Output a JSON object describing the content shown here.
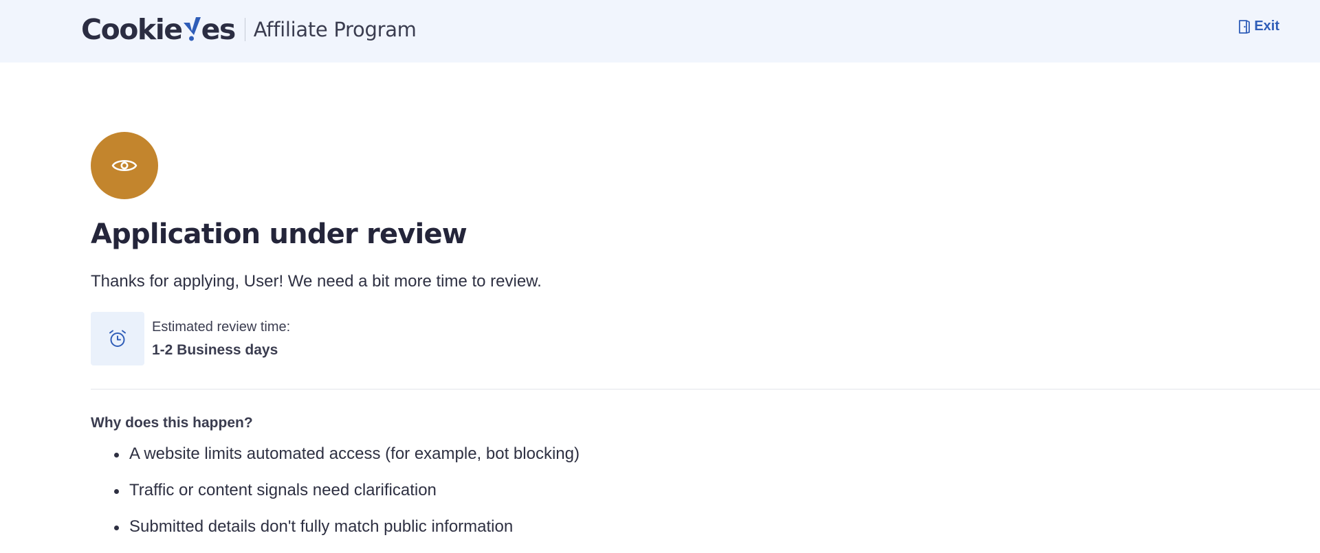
{
  "header": {
    "logo_text_part1": "Cookie",
    "logo_text_part2": "es",
    "logo_program": "Affiliate Program",
    "exit_label": "Exit"
  },
  "status": {
    "icon": "eye-icon",
    "color": "#c3852d",
    "title": "Application under review",
    "message": "Thanks for applying, User! We need a bit more time to review."
  },
  "review": {
    "icon": "alarm-clock-icon",
    "label": "Estimated review time:",
    "value": "1-2 Business days"
  },
  "why": {
    "title": "Why does this happen?",
    "reasons": [
      "A website limits automated access (for example, bot blocking)",
      "Traffic or content signals need clarification",
      "Submitted details don't fully match public information"
    ]
  },
  "colors": {
    "header_bg": "#f1f5fd",
    "accent_blue": "#2f5db8",
    "text_dark": "#24253a",
    "tile_bg": "#eaf1fb"
  }
}
